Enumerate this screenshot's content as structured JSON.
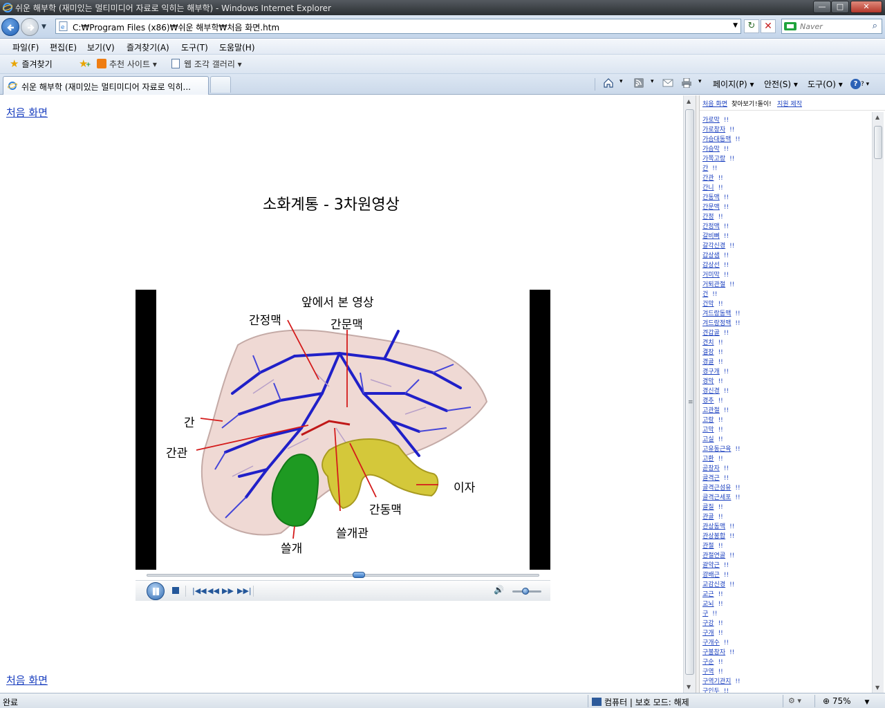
{
  "window": {
    "title": "쉬운 해부학 (재미있는 멀티미디어 자료로 익히는 해부학) - Windows Internet Explorer",
    "minimize": "—",
    "maximize": "□",
    "close": "✕"
  },
  "address": {
    "url": "C:₩Program Files (x86)₩쉬운 해부학₩처음 화면.htm",
    "refresh": "↻",
    "stop": "✕",
    "search_placeholder": "Naver",
    "search_go": "⌕"
  },
  "menu": [
    "파일(F)",
    "편집(E)",
    "보기(V)",
    "즐겨찾기(A)",
    "도구(T)",
    "도움말(H)"
  ],
  "favorites": {
    "label": "즐겨찾기",
    "suggested": "추천 사이트 ▾",
    "webslice": "웹 조각 갤러리 ▾"
  },
  "tab": {
    "label": "쉬운 해부학 (재미있는 멀티미디어 자료로 익히..."
  },
  "commands": {
    "page": "페이지(P) ▾",
    "safety": "안전(S) ▾",
    "tools": "도구(O) ▾",
    "help": "? ▾",
    "home_dd": "▾",
    "feed_dd": "▾",
    "print_dd": "▾"
  },
  "content": {
    "home_link": "처음 화면",
    "title": "소화계통 - 3차원영상",
    "video_labels": {
      "front_view": "앞에서 본 영상",
      "hepatic_vein": "간정맥",
      "portal_vein": "간문맥",
      "liver": "간",
      "hepatic_duct": "간관",
      "pancreas": "이자",
      "hepatic_artery": "간동맥",
      "bile_duct": "쓸개관",
      "gallbladder": "쓸개"
    }
  },
  "player": {
    "seek_progress": 0.54,
    "volume": 0.45,
    "prev": "|◀◀",
    "rewind": "◀◀",
    "ffwd": "▶▶",
    "next": "▶▶|",
    "volume_icon": "🔊"
  },
  "index": {
    "header_home": "처음 화면",
    "header_find": "찾아보기",
    "header_link1": "지원 제작",
    "header_extra": "!돌이!",
    "mark": "!!",
    "terms": [
      "가로막",
      "가로창자",
      "가슴대동맥",
      "가슴막",
      "가쪽고랑",
      "간",
      "간관",
      "간니",
      "간동맥",
      "간문맥",
      "간정",
      "간정맥",
      "갈비뼈",
      "갈각신경",
      "갑상샘",
      "갑상선",
      "거미막",
      "거퇴관절",
      "건",
      "건막",
      "겨드랑동맥",
      "겨드랑정맥",
      "견갑골",
      "견치",
      "결장",
      "경골",
      "경구개",
      "경막",
      "경신경",
      "경추",
      "고관절",
      "고랑",
      "고막",
      "고실",
      "고유동근육",
      "고환",
      "곧창자",
      "골격근",
      "골격근섬유",
      "골격근세포",
      "골질",
      "관골",
      "관상동맥",
      "관상봉합",
      "관절",
      "관절연골",
      "괄약근",
      "광배근",
      "교감신경",
      "교근",
      "교뇌",
      "구",
      "구강",
      "구개",
      "구개수",
      "구불창자",
      "구순",
      "구역",
      "구역기관지",
      "구인두"
    ]
  },
  "status": {
    "text": "완료",
    "zone": "컴퓨터 | 보호 모드: 해제",
    "zoom": "75%"
  }
}
